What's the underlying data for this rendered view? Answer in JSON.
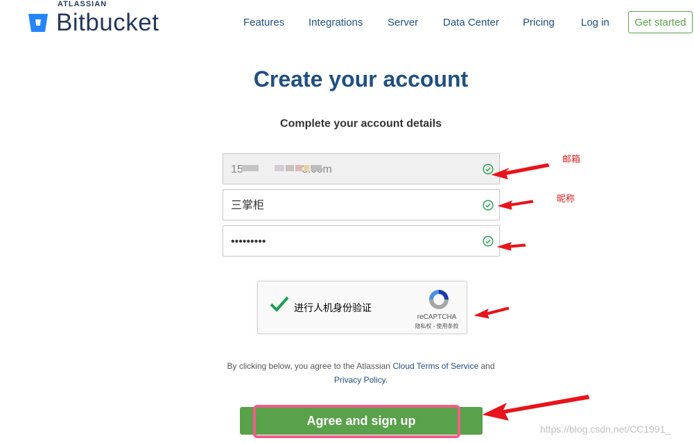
{
  "brand": {
    "company": "ATLASSIAN",
    "product": "Bitbucket"
  },
  "nav": {
    "features": "Features",
    "integrations": "Integrations",
    "server": "Server",
    "data_center": "Data Center",
    "pricing": "Pricing",
    "login": "Log in",
    "get_started": "Get started"
  },
  "page": {
    "title": "Create your account",
    "subtitle": "Complete your account details"
  },
  "form": {
    "email_value": "15                   3.com",
    "name_value": "三掌柜",
    "password_value": "•••••••••",
    "valid_icon": "check-circle-icon"
  },
  "captcha": {
    "label": "进行人机身份验证",
    "brand": "reCAPTCHA",
    "links": "隐私权 - 使用条款"
  },
  "terms": {
    "prefix": "By clicking below, you agree to the Atlassian ",
    "cloud_terms": "Cloud Terms of Service",
    "and": " and",
    "privacy": "Privacy Policy",
    "suffix": "."
  },
  "submit": {
    "label": "Agree and sign up"
  },
  "annotations": {
    "email_note": "邮箱",
    "nickname_note": "昵称",
    "watermark": "https://blog.csdn.net/CC1991_"
  },
  "colors": {
    "brand_blue": "#205081",
    "logo_blue": "#2684ff",
    "success_green": "#59a14a",
    "annotation_red": "#e02020",
    "highlight_pink": "#f25c8a"
  }
}
